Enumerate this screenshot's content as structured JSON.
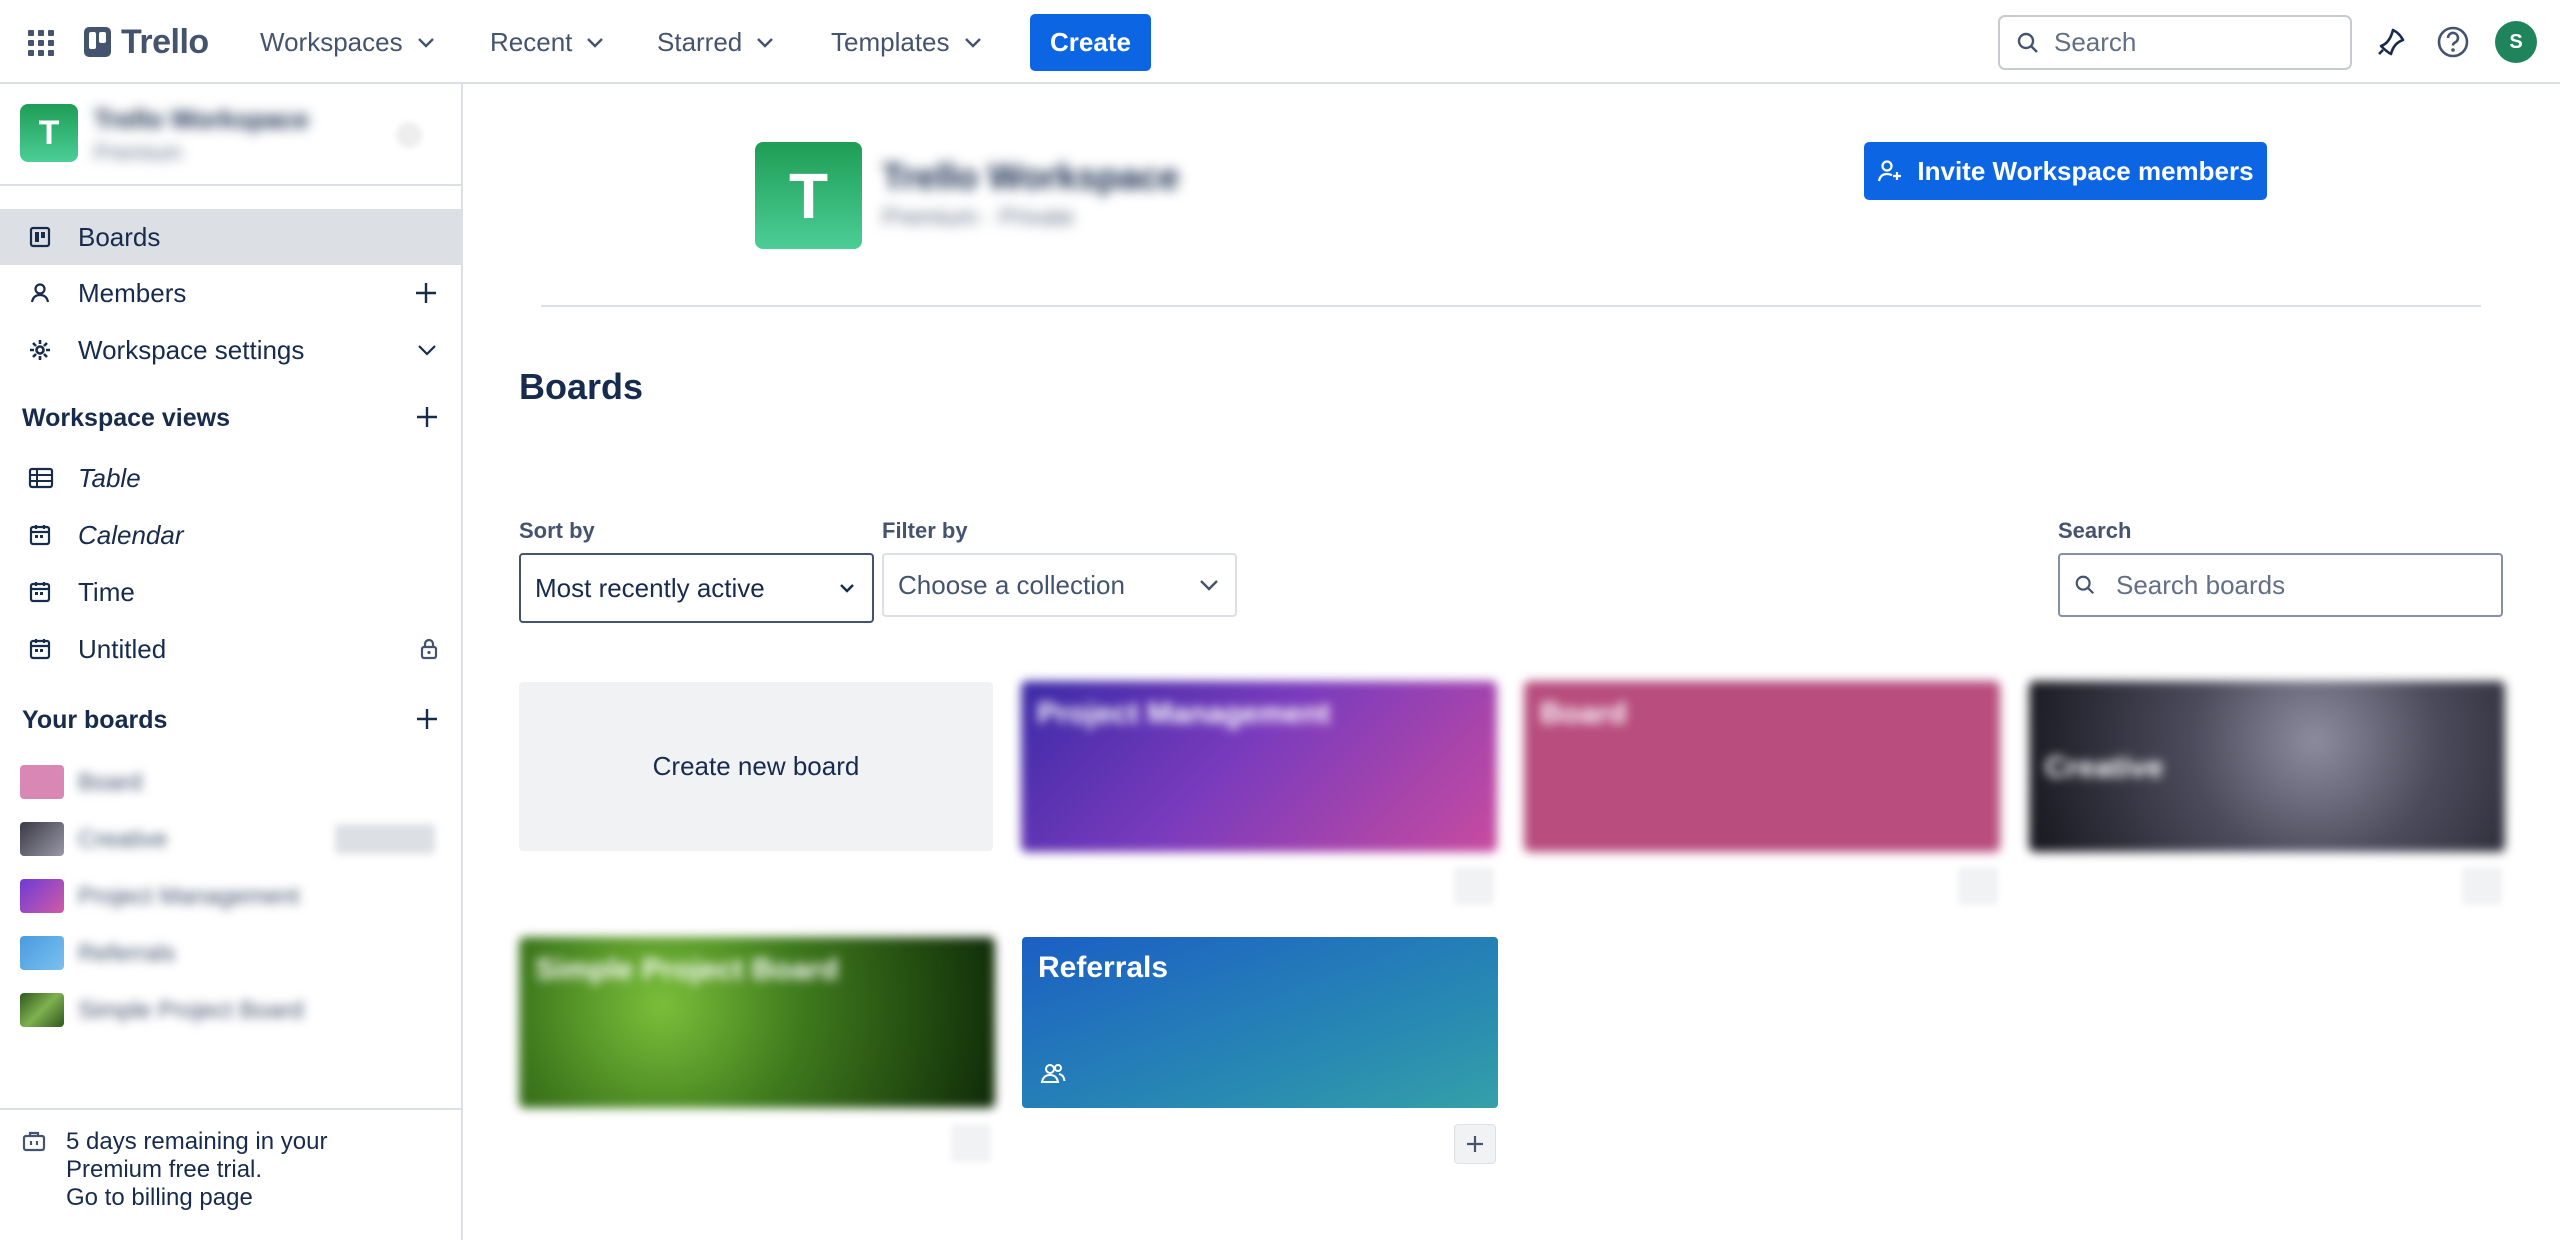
{
  "header": {
    "logo_text": "Trello",
    "nav": [
      {
        "label": "Workspaces"
      },
      {
        "label": "Recent"
      },
      {
        "label": "Starred"
      },
      {
        "label": "Templates"
      }
    ],
    "create_label": "Create",
    "search_placeholder": "Search",
    "avatar_initial": "S"
  },
  "sidebar": {
    "workspace_initial": "T",
    "workspace_name": "Trello Workspace",
    "workspace_plan": "Premium",
    "items": [
      {
        "label": "Boards"
      },
      {
        "label": "Members"
      },
      {
        "label": "Workspace settings"
      }
    ],
    "views_heading": "Workspace views",
    "views": [
      {
        "label": "Table"
      },
      {
        "label": "Calendar"
      },
      {
        "label": "Time"
      },
      {
        "label": "Untitled"
      }
    ],
    "boards_heading": "Your boards",
    "boards": [
      {
        "label": "Board"
      },
      {
        "label": "Creative"
      },
      {
        "label": "Project Management"
      },
      {
        "label": "Referrals"
      },
      {
        "label": "Simple Project Board"
      }
    ],
    "trial": {
      "line1": "5 days remaining in your",
      "line2": "Premium free trial.",
      "link": "Go to billing page"
    }
  },
  "main": {
    "workspace_initial": "T",
    "workspace_title": "Trello Workspace",
    "workspace_sub": "Premium · Private",
    "invite_label": "Invite Workspace members",
    "boards_title": "Boards",
    "sort": {
      "label": "Sort by",
      "value": "Most recently active"
    },
    "filter": {
      "label": "Filter by",
      "value": "Choose a collection"
    },
    "search": {
      "label": "Search",
      "placeholder": "Search boards"
    },
    "create_new_board": "Create new board",
    "cards": [
      {
        "title": "Project Management"
      },
      {
        "title": "Board"
      },
      {
        "title": "Creative"
      },
      {
        "title": "Simple Project Board"
      },
      {
        "title": "Referrals"
      }
    ]
  },
  "colors": {
    "accent": "#0c66e4",
    "workspace_green": "#1f9d55",
    "avatar_green": "#1f845a",
    "text": "#172b4d",
    "subtle": "#44546f"
  }
}
